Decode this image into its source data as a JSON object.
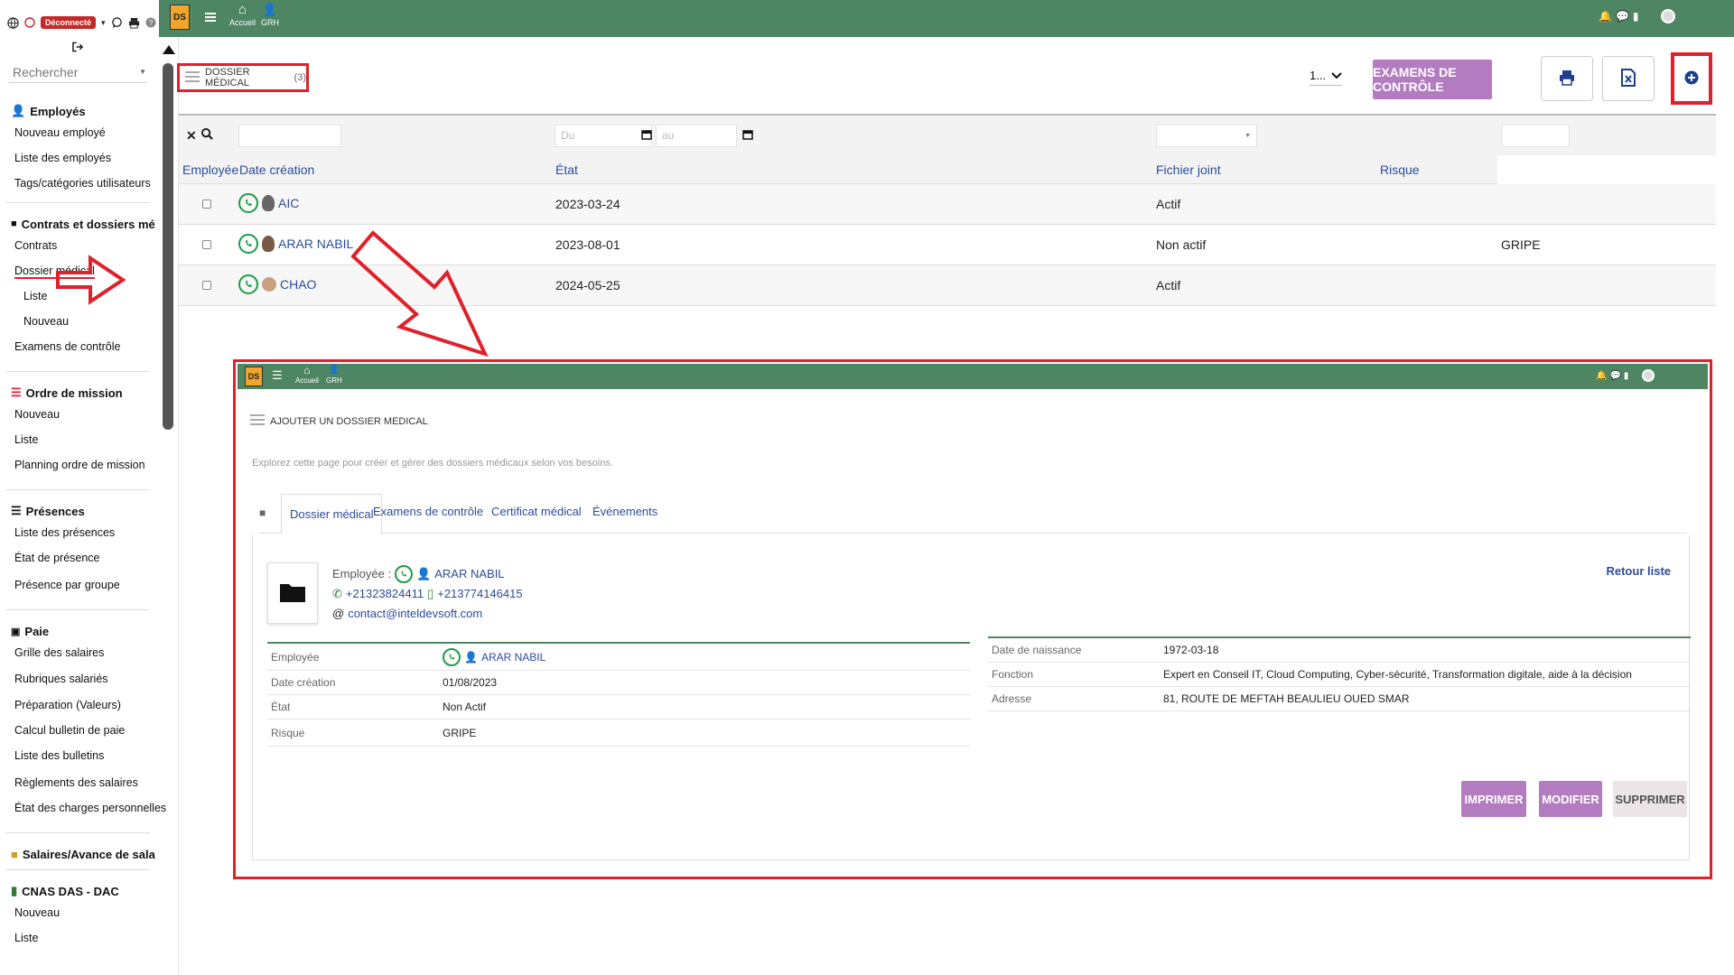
{
  "sidebar": {
    "disconnected_label": "Déconnecté",
    "search_placeholder": "Rechercher",
    "sections": {
      "employes": "Employés",
      "contrats": "Contrats et dossiers mé...",
      "ordre": "Ordre de mission",
      "presences": "Présences",
      "paie": "Paie",
      "salaires": "Salaires/Avance de salaire",
      "cnas": "CNAS DAS - DAC"
    },
    "items": {
      "nouveau_employe": "Nouveau employé",
      "liste_employes": "Liste des employés",
      "tags": "Tags/catégories utilisateurs",
      "contrats": "Contrats",
      "dossier_medical": "Dossier médical",
      "dm_liste": "Liste",
      "dm_nouveau": "Nouveau",
      "examens": "Examens de contrôle",
      "om_nouveau": "Nouveau",
      "om_liste": "Liste",
      "om_planning": "Planning ordre de mission",
      "liste_presences": "Liste des présences",
      "etat_presence": "État de présence",
      "presence_groupe": "Présence par groupe",
      "grille": "Grille des salaires",
      "rubriques": "Rubriques salariés",
      "preparation": "Préparation (Valeurs)",
      "calcul": "Calcul bulletin de paie",
      "liste_bulletins": "Liste des bulletins",
      "reglements": "Règlements des salaires",
      "etat_charges": "État des charges personnelles",
      "cnas_nouveau": "Nouveau",
      "cnas_liste": "Liste"
    }
  },
  "topbar": {
    "logo": "DS",
    "nav_home": "Accueil",
    "nav_grh": "GRH"
  },
  "header": {
    "title": "DOSSIER MÉDICAL",
    "count": "(3)",
    "items_per_page": "1...",
    "exams_button": "EXAMENS DE CONTRÔLE"
  },
  "table": {
    "filter_from_placeholder": "Du",
    "filter_to_placeholder": "au",
    "columns": [
      "Employée",
      "Date création",
      "État",
      "Fichier joint",
      "Risque"
    ],
    "rows": [
      {
        "employee": "AIC",
        "date": "2023-03-24",
        "etat": "Actif",
        "risque": ""
      },
      {
        "employee": "ARAR NABIL",
        "date": "2023-08-01",
        "etat": "Non actif",
        "risque": "GRIPE"
      },
      {
        "employee": "CHAO",
        "date": "2024-05-25",
        "etat": "Actif",
        "risque": ""
      }
    ]
  },
  "inset": {
    "topbar": {
      "logo": "DS",
      "nav_home": "Accueil",
      "nav_grh": "GRH"
    },
    "title": "AJOUTER UN DOSSIER MEDICAL",
    "description": "Explorez cette page pour créer et gérer des dossiers médicaux selon vos besoins.",
    "tabs": [
      "Dossier médical",
      "Examens de contrôle",
      "Certificat médical",
      "Événements"
    ],
    "employee_label": "Employée :",
    "employee_name": "ARAR NABIL",
    "phone": "+21323824411",
    "mobile": "+213774146415",
    "email": "contact@inteldevsoft.com",
    "back_link": "Retour liste",
    "left_details": [
      {
        "key": "Employée",
        "value": "ARAR NABIL"
      },
      {
        "key": "Date création",
        "value": "01/08/2023"
      },
      {
        "key": "État",
        "value": "Non Actif"
      },
      {
        "key": "Risque",
        "value": "GRIPE"
      }
    ],
    "right_details": [
      {
        "key": "Date de naissance",
        "value": "1972-03-18"
      },
      {
        "key": "Fonction",
        "value": "Expert en Conseil IT, Cloud Computing, Cyber-sécurité, Transformation digitale, aide à la décision"
      },
      {
        "key": "Adresse",
        "value": "81, ROUTE DE MEFTAH BEAULIEU OUED SMAR"
      }
    ],
    "buttons": {
      "print": "IMPRIMER",
      "edit": "MODIFIER",
      "delete": "SUPPRIMER"
    }
  },
  "colors": {
    "brand_green": "#4e8563",
    "accent_purple": "#b47cc0",
    "highlight_red": "#e0202a",
    "link_blue": "#2b4d9a"
  }
}
